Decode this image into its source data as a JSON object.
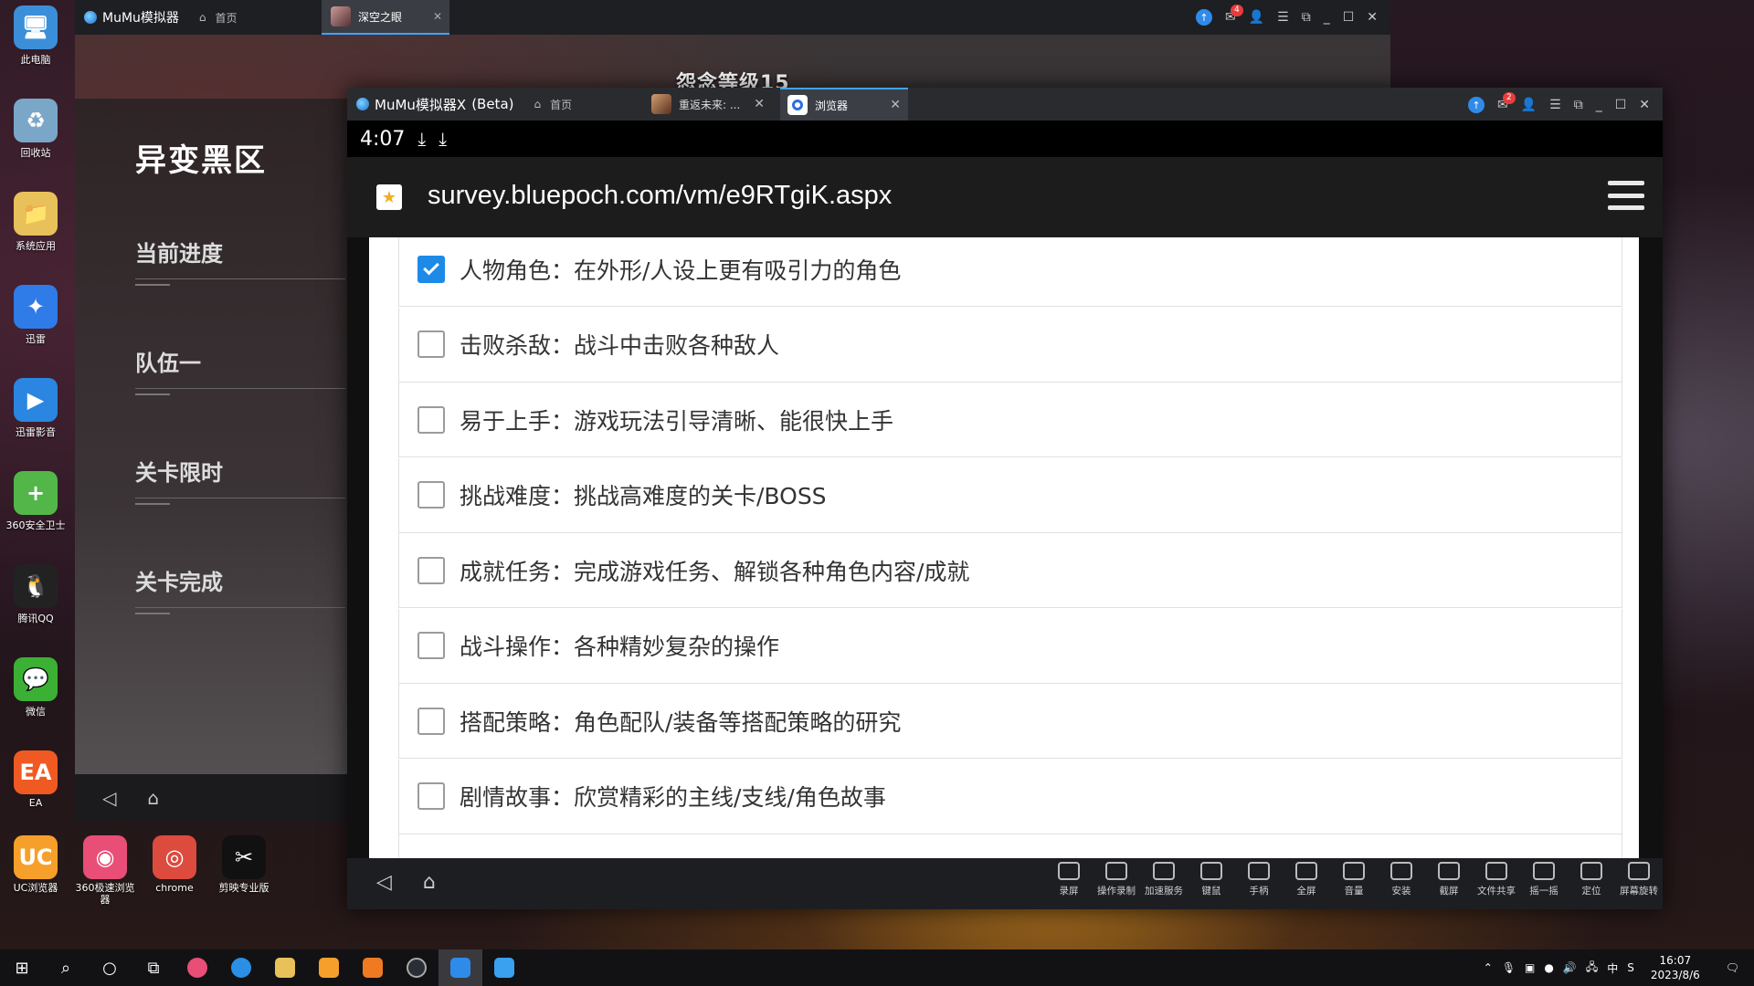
{
  "desktop": {
    "icons": [
      {
        "label": "此电脑",
        "icon": "computer-icon",
        "color": "#3b8fd9"
      },
      {
        "label": "回收站",
        "icon": "recycle-bin-icon",
        "color": "#7aa6c8"
      },
      {
        "label": "系统应用",
        "icon": "folder-icon",
        "color": "#e8c15a"
      },
      {
        "label": "迅雷",
        "icon": "thunder-icon",
        "color": "#2f7be8"
      },
      {
        "label": "迅雷影音",
        "icon": "thunder-player-icon",
        "color": "#2a86e0"
      },
      {
        "label": "360安全卫士",
        "icon": "360-safe-icon",
        "color": "#52b748"
      },
      {
        "label": "腾讯QQ",
        "icon": "qq-icon",
        "color": "#222"
      },
      {
        "label": "微信",
        "icon": "wechat-icon",
        "color": "#3cb035"
      },
      {
        "label": "EA",
        "icon": "ea-icon",
        "color": "#f05a22"
      }
    ],
    "bottom_icons": [
      {
        "label": "UC浏览器",
        "icon": "uc-browser-icon",
        "color": "#f6a02b"
      },
      {
        "label": "360极速浏览器",
        "icon": "360-browser-icon",
        "color": "#e94e77"
      },
      {
        "label": "chrome",
        "icon": "chrome-icon",
        "color": "#dc4b3e"
      },
      {
        "label": "剪映专业版",
        "icon": "capcut-icon",
        "color": "#111"
      }
    ]
  },
  "back_window": {
    "brand": "MuMu模拟器",
    "home_label": "首页",
    "active_tab": "深空之眼",
    "game": {
      "level_title": "怨念等级15",
      "zone_title": "异变黑区",
      "menu": [
        "当前进度",
        "队伍一",
        "关卡限时",
        "关卡完成"
      ]
    }
  },
  "front_window": {
    "brand": "MuMu模拟器X",
    "brand_suffix": "(Beta)",
    "home_label": "首页",
    "tabs": [
      {
        "label": "重返未来: ...",
        "active": false
      },
      {
        "label": "浏览器",
        "active": true
      }
    ],
    "mail_badge": "2",
    "status": {
      "time": "4:07"
    },
    "url": "survey.bluepoch.com/vm/e9RTgiK.aspx",
    "options": [
      {
        "text": "人物角色：在外形/人设上更有吸引力的角色",
        "checked": true
      },
      {
        "text": "击败杀敌：战斗中击败各种敌人",
        "checked": false
      },
      {
        "text": "易于上手：游戏玩法引导清晰、能很快上手",
        "checked": false
      },
      {
        "text": "挑战难度：挑战高难度的关卡/BOSS",
        "checked": false
      },
      {
        "text": "成就任务：完成游戏任务、解锁各种角色内容/成就",
        "checked": false
      },
      {
        "text": "战斗操作：各种精妙复杂的操作",
        "checked": false
      },
      {
        "text": "搭配策略：角色配队/装备等搭配策略的研究",
        "checked": false
      },
      {
        "text": "剧情故事：欣赏精彩的主线/支线/角色故事",
        "checked": false
      }
    ],
    "tools": [
      "录屏",
      "操作录制",
      "加速服务",
      "键鼠",
      "手柄",
      "全屏",
      "音量",
      "安装",
      "截屏",
      "文件共享",
      "摇一摇",
      "定位",
      "屏幕旋转"
    ]
  },
  "back_mail_badge": "4",
  "taskbar": {
    "time": "16:07",
    "date": "2023/8/6",
    "ime": "中"
  },
  "colors": {
    "accent": "#1d8ae8",
    "tab_highlight": "#3fa5ff"
  }
}
